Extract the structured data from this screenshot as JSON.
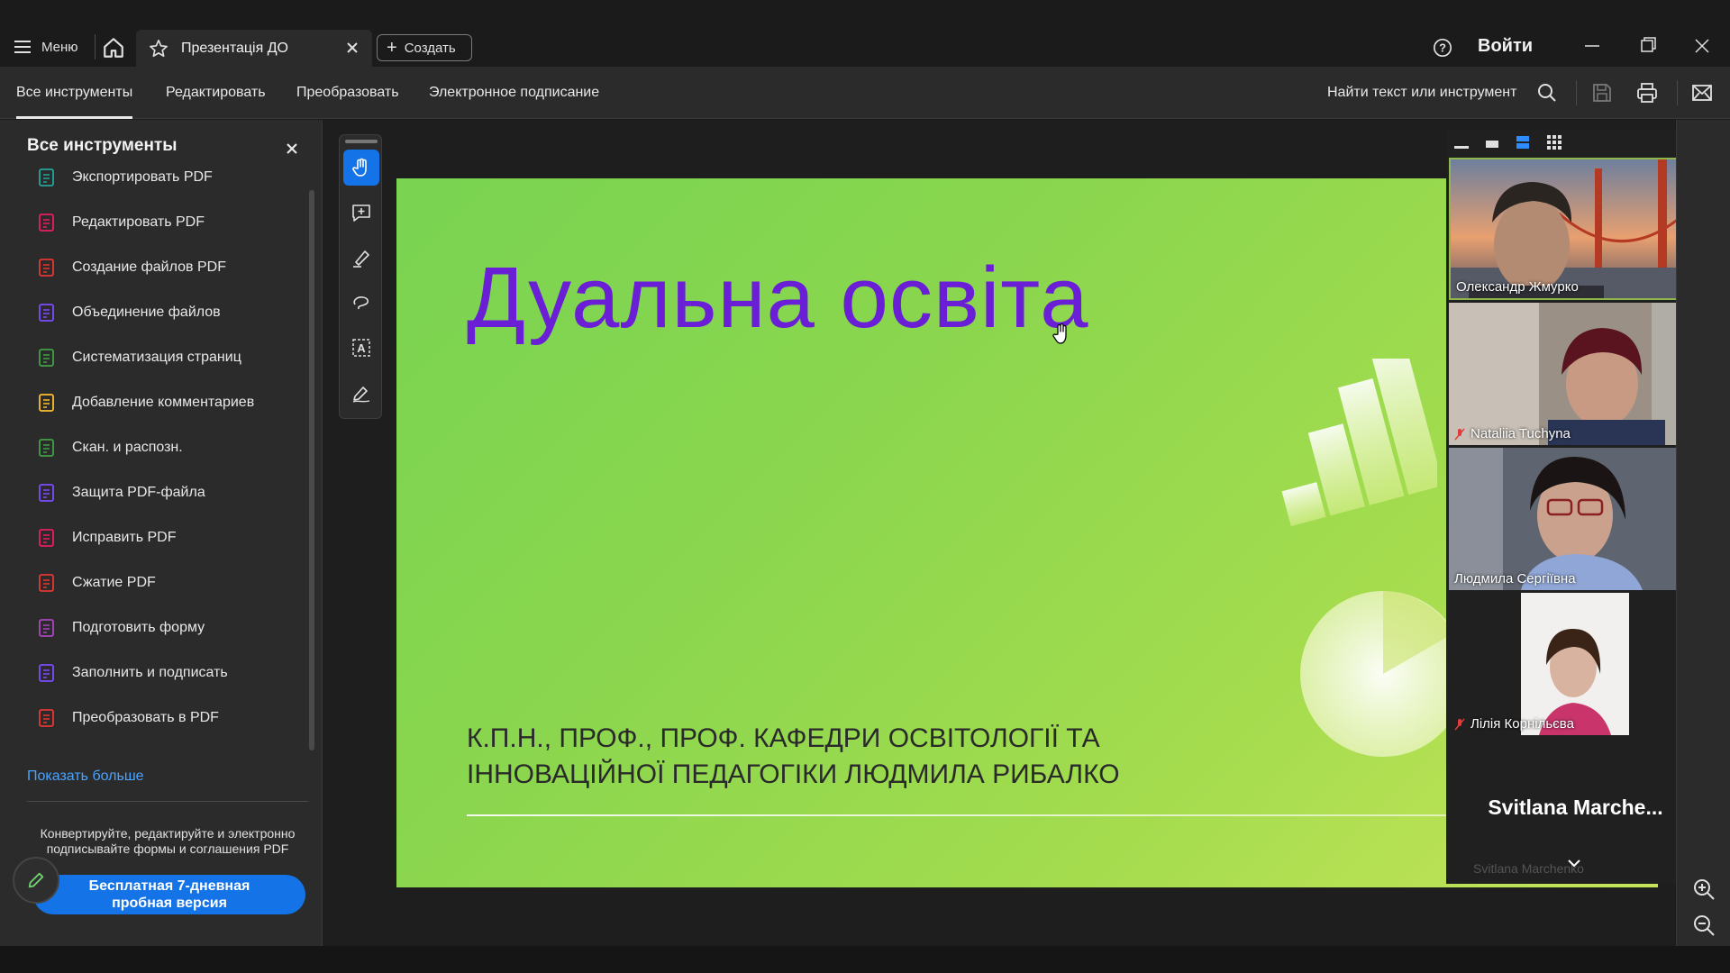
{
  "titlebar": {
    "menu_label": "Меню",
    "tab_title": "Презентація ДО",
    "create_label": "Создать",
    "signin_label": "Войти"
  },
  "toolbar": {
    "tabs": [
      "Все инструменты",
      "Редактировать",
      "Преобразовать",
      "Электронное подписание"
    ],
    "find_placeholder": "Найти текст или инструмент"
  },
  "sidebar": {
    "title": "Все инструменты",
    "items": [
      {
        "label": "Экспортировать PDF",
        "color": "#26a69a"
      },
      {
        "label": "Редактировать PDF",
        "color": "#e91e63"
      },
      {
        "label": "Создание файлов PDF",
        "color": "#e53935"
      },
      {
        "label": "Объединение файлов",
        "color": "#7c4dff"
      },
      {
        "label": "Систематизация страниц",
        "color": "#43a047"
      },
      {
        "label": "Добавление комментариев",
        "color": "#fbc02d"
      },
      {
        "label": "Скан. и распозн.",
        "color": "#43a047"
      },
      {
        "label": "Защита PDF-файла",
        "color": "#7c4dff"
      },
      {
        "label": "Исправить PDF",
        "color": "#e91e63"
      },
      {
        "label": "Сжатие PDF",
        "color": "#e53935"
      },
      {
        "label": "Подготовить форму",
        "color": "#ab47bc"
      },
      {
        "label": "Заполнить и подписать",
        "color": "#7c4dff"
      },
      {
        "label": "Преобразовать в PDF",
        "color": "#e53935"
      }
    ],
    "show_more": "Показать больше",
    "promo_text": "Конвертируйте, редактируйте и электронно подписывайте формы и соглашения PDF",
    "trial_line1": "Бесплатная 7-дневная",
    "trial_line2": "пробная версия"
  },
  "slide": {
    "title": "Дуальна освіта",
    "subtitle_line1": "К.П.Н., ПРОФ., ПРОФ. КАФЕДРИ ОСВІТОЛОГІЇ ТА",
    "subtitle_line2": "ІННОВАЦІЙНОЇ ПЕДАГОГІКИ ЛЮДМИЛА РИБАЛКО"
  },
  "video": {
    "participants": [
      {
        "name": "Олександр Жмурко",
        "muted": false,
        "speaking": true
      },
      {
        "name": "Nataliia Tuchyna",
        "muted": true,
        "speaking": false
      },
      {
        "name": "Людмила Сергіївна",
        "muted": false,
        "speaking": false
      },
      {
        "name": "Лілія Корнільєва",
        "muted": true,
        "speaking": false
      }
    ],
    "big_name": "Svitlana  Marche...",
    "faded_name": "Svitlana Marchenko"
  }
}
